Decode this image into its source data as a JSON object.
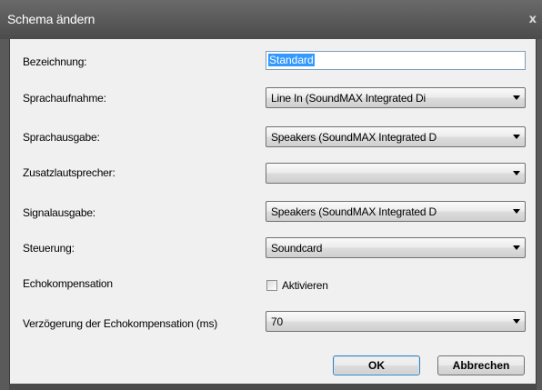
{
  "window": {
    "title": "Schema ändern",
    "close": "x"
  },
  "fields": {
    "bezeichnung": {
      "label": "Bezeichnung:",
      "value": "Standard"
    },
    "sprachaufnahme": {
      "label": "Sprachaufnahme:",
      "value": "Line In (SoundMAX Integrated Di"
    },
    "sprachausgabe": {
      "label": "Sprachausgabe:",
      "value": "Speakers (SoundMAX Integrated D"
    },
    "zusatzlautsprecher": {
      "label": "Zusatzlautsprecher:",
      "value": ""
    },
    "signalausgabe": {
      "label": "Signalausgabe:",
      "value": "Speakers (SoundMAX Integrated D"
    },
    "steuerung": {
      "label": "Steuerung:",
      "value": "Soundcard"
    },
    "echokompensation": {
      "label": "Echokompensation",
      "checkbox_label": "Aktivieren",
      "checked": false
    },
    "verzoegerung": {
      "label": "Verzögerung der Echokompensation  (ms)",
      "value": "70"
    }
  },
  "buttons": {
    "ok": "OK",
    "cancel": "Abbrechen"
  }
}
